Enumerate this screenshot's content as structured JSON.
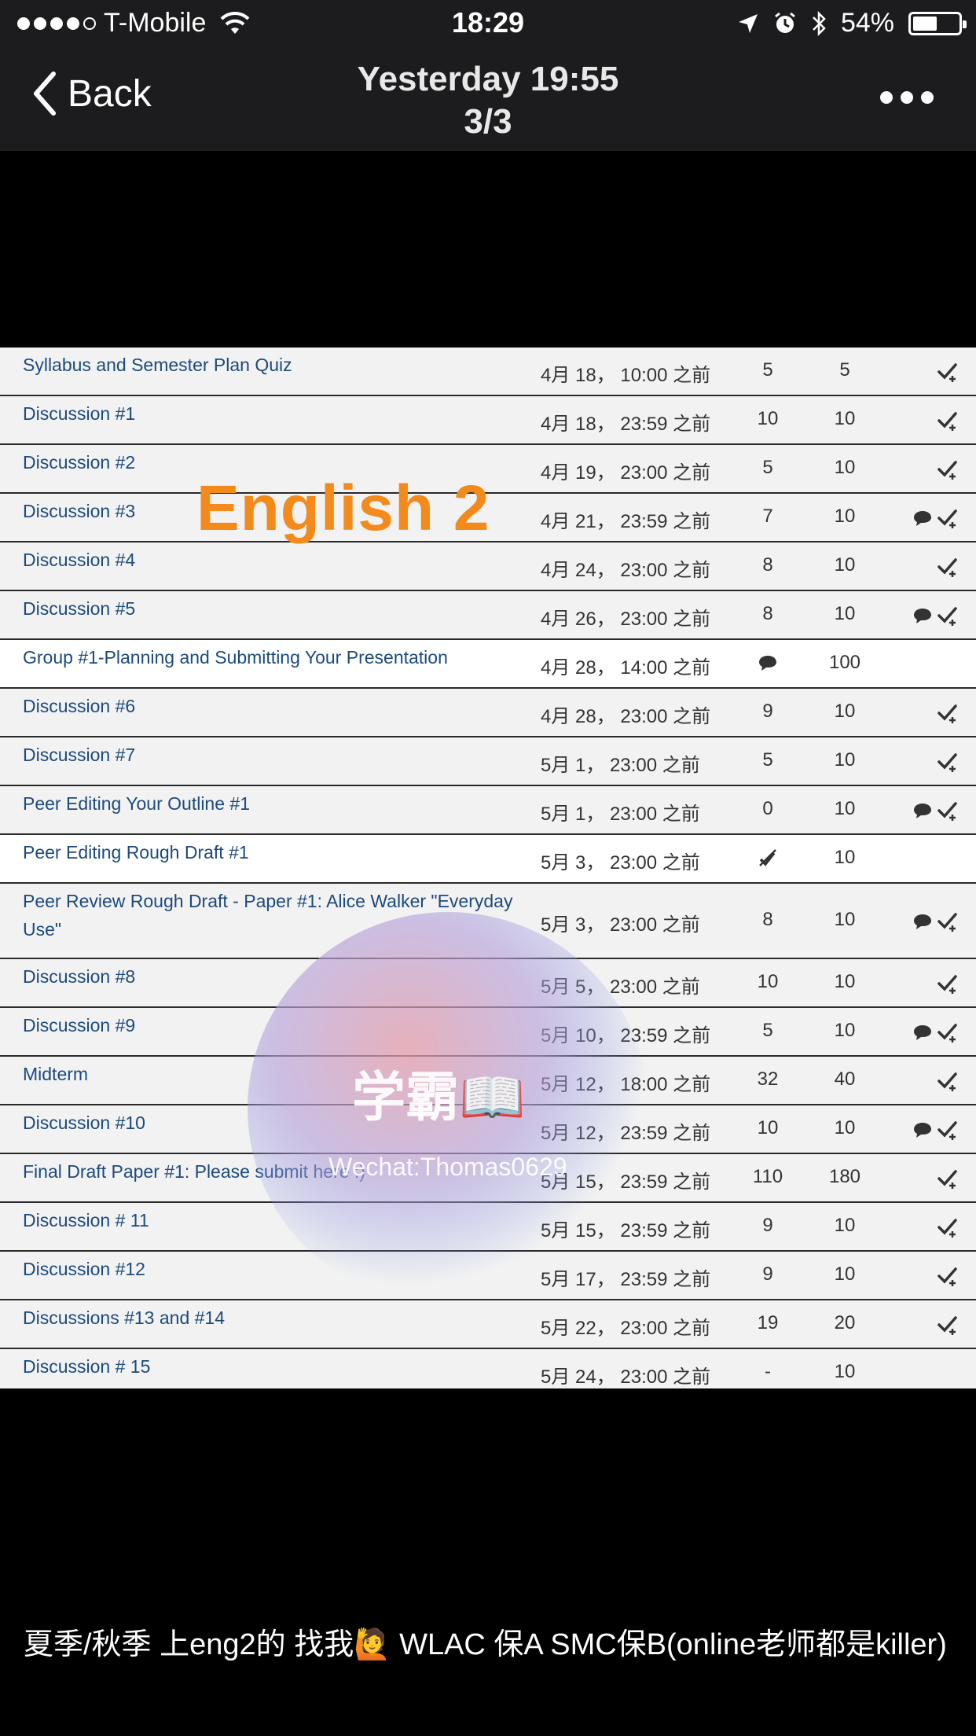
{
  "status_bar": {
    "carrier": "T-Mobile",
    "time": "18:29",
    "battery": "54%",
    "battery_level": 0.54
  },
  "nav": {
    "back_label": "Back",
    "title_line1": "Yesterday 19:55",
    "title_line2": "3/3"
  },
  "overlay": {
    "title": "English 2",
    "watermark_text": "学霸📖",
    "watermark_sub": "Wechat:Thomas0629"
  },
  "rows": [
    {
      "title": "Syllabus and Semester Plan Quiz",
      "date": "4月 18， 10:00 之前",
      "score": "5",
      "total": "5",
      "comment": false,
      "check": true,
      "shade": true
    },
    {
      "title": "Discussion #1",
      "date": "4月 18， 23:59 之前",
      "score": "10",
      "total": "10",
      "comment": false,
      "check": true,
      "shade": true
    },
    {
      "title": "Discussion #2",
      "date": "4月 19， 23:00 之前",
      "score": "5",
      "total": "10",
      "comment": false,
      "check": true,
      "shade": true
    },
    {
      "title": "Discussion #3",
      "date": "4月 21， 23:59 之前",
      "score": "7",
      "total": "10",
      "comment": true,
      "check": true,
      "shade": true
    },
    {
      "title": "Discussion #4",
      "date": "4月 24， 23:00 之前",
      "score": "8",
      "total": "10",
      "comment": false,
      "check": true,
      "shade": true
    },
    {
      "title": "Discussion #5",
      "date": "4月 26， 23:00 之前",
      "score": "8",
      "total": "10",
      "comment": true,
      "check": true,
      "shade": true
    },
    {
      "title": "Group #1-Planning and Submitting Your Presentation",
      "date": "4月 28， 14:00 之前",
      "score": "",
      "score_icon": "comment-icon",
      "total": "100",
      "comment": false,
      "check": false,
      "shade": false
    },
    {
      "title": "Discussion #6",
      "date": "4月 28， 23:00 之前",
      "score": "9",
      "total": "10",
      "comment": false,
      "check": true,
      "shade": true
    },
    {
      "title": "Discussion #7",
      "date": "5月 1， 23:00 之前",
      "score": "5",
      "total": "10",
      "comment": false,
      "check": true,
      "shade": true
    },
    {
      "title": "Peer Editing Your Outline #1",
      "date": "5月 1， 23:00 之前",
      "score": "0",
      "total": "10",
      "comment": true,
      "check": true,
      "shade": true
    },
    {
      "title": "Peer Editing Rough Draft #1",
      "date": "5月 3， 23:00 之前",
      "score": "",
      "score_icon": "missing-icon",
      "total": "10",
      "comment": false,
      "check": false,
      "shade": false
    },
    {
      "title": "Peer Review Rough Draft - Paper #1: Alice Walker \"Everyday Use\"",
      "date": "5月 3， 23:00 之前",
      "score": "8",
      "total": "10",
      "comment": true,
      "check": true,
      "shade": true,
      "tall": true
    },
    {
      "title": "Discussion #8",
      "date": "5月 5， 23:00 之前",
      "score": "10",
      "total": "10",
      "comment": false,
      "check": true,
      "shade": true
    },
    {
      "title": "Discussion #9",
      "date": "5月 10， 23:59 之前",
      "score": "5",
      "total": "10",
      "comment": true,
      "check": true,
      "shade": true
    },
    {
      "title": "Midterm",
      "date": "5月 12， 18:00 之前",
      "score": "32",
      "total": "40",
      "comment": false,
      "check": true,
      "shade": true
    },
    {
      "title": "Discussion #10",
      "date": "5月 12， 23:59 之前",
      "score": "10",
      "total": "10",
      "comment": true,
      "check": true,
      "shade": true
    },
    {
      "title": "Final Draft Paper #1: Please submit here :)",
      "date": "5月 15， 23:59 之前",
      "score": "110",
      "total": "180",
      "comment": false,
      "check": true,
      "shade": true
    },
    {
      "title": "Discussion # 11",
      "date": "5月 15， 23:59 之前",
      "score": "9",
      "total": "10",
      "comment": false,
      "check": true,
      "shade": true
    },
    {
      "title": "Discussion #12",
      "date": "5月 17， 23:59 之前",
      "score": "9",
      "total": "10",
      "comment": false,
      "check": true,
      "shade": true
    },
    {
      "title": "Discussions #13 and #14",
      "date": "5月 22， 23:00 之前",
      "score": "19",
      "total": "20",
      "comment": false,
      "check": true,
      "shade": true
    },
    {
      "title": "Discussion # 15",
      "date": "5月 24， 23:00 之前",
      "score": "-",
      "total": "10",
      "comment": false,
      "check": false,
      "shade": true
    }
  ],
  "caption": "夏季/秋季 上eng2的 找我🙋 WLAC 保A SMC保B(online老师都是killer)"
}
